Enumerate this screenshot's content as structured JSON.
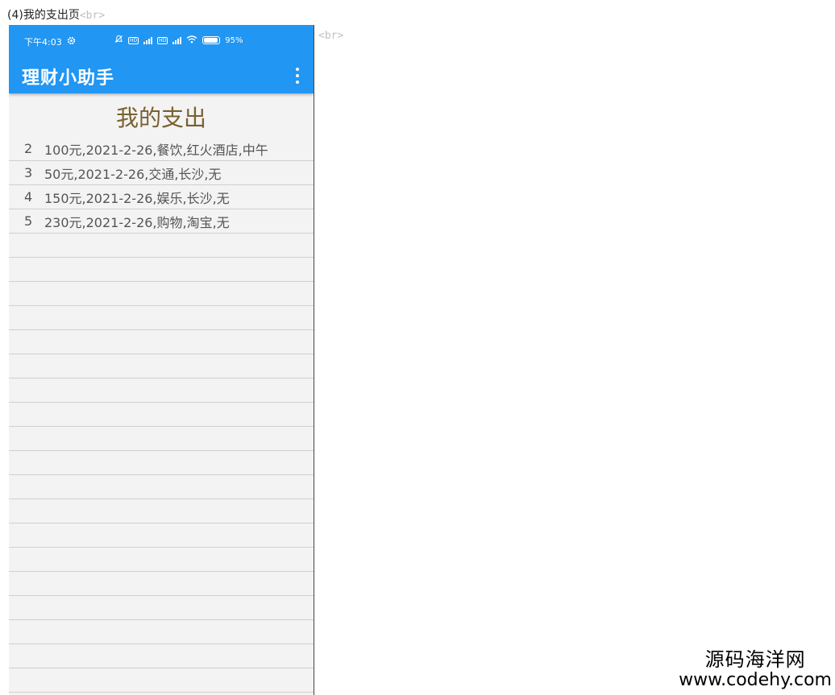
{
  "caption": {
    "text": "(4)我的支出页",
    "br_tag": "<br>"
  },
  "right_br_tag": "<br>",
  "status_bar": {
    "time": "下午4:03",
    "battery": "95%",
    "icons": [
      "settings-icon",
      "notification-muted-icon",
      "hd-icon",
      "signal-4g-icon",
      "wifi-icon",
      "battery-icon"
    ]
  },
  "app_bar": {
    "title": "理财小助手",
    "menu_icon": "more-vert-icon"
  },
  "heading": "我的支出",
  "expenses": [
    {
      "index": "2",
      "text": "100元,2021-2-26,餐饮,红火酒店,中午"
    },
    {
      "index": "3",
      "text": "50元,2021-2-26,交通,长沙,无"
    },
    {
      "index": "4",
      "text": "150元,2021-2-26,娱乐,长沙,无"
    },
    {
      "index": "5",
      "text": "230元,2021-2-26,购物,淘宝,无"
    }
  ],
  "watermark": {
    "cn": "源码海洋网",
    "url": "www.codehy.com"
  },
  "colors": {
    "primary": "#2196f3",
    "heading": "#7a6130",
    "background": "#f3f3f3"
  }
}
